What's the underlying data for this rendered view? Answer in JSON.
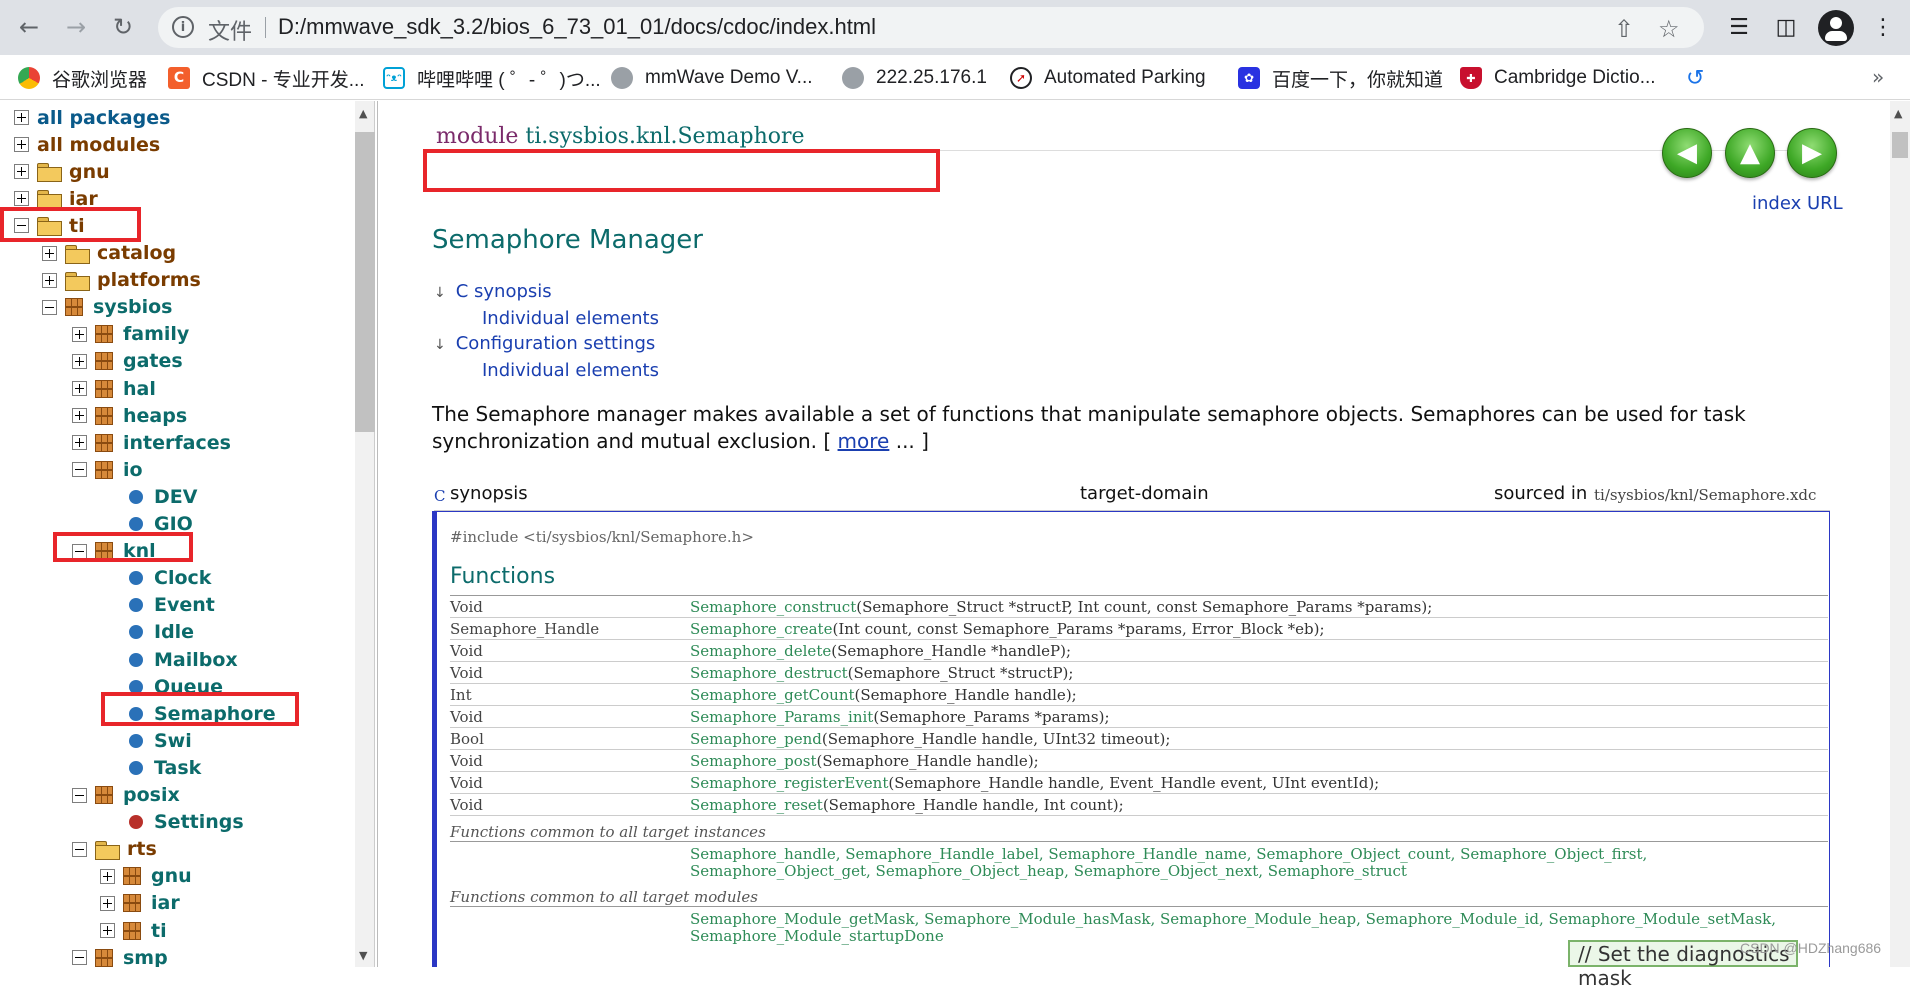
{
  "browser": {
    "url_chip": "文件",
    "url": "D:/mmwave_sdk_3.2/bios_6_73_01_01/docs/cdoc/index.html",
    "bookmarks": [
      "谷歌浏览器",
      "CSDN - 专业开发...",
      "哔哩哔哩 ( ゜- ゜)つ...",
      "mmWave Demo V...",
      "222.25.176.1",
      "Automated Parking",
      "百度一下，你就知道",
      "Cambridge Dictio..."
    ],
    "bookmark_more": "»"
  },
  "tree": {
    "items": [
      {
        "label": "all packages",
        "depth": 0,
        "toggle": "plus",
        "icon": "none",
        "color": "#0a5a8a"
      },
      {
        "label": "all modules",
        "depth": 0,
        "toggle": "plus",
        "icon": "none",
        "color": "#7a3c00"
      },
      {
        "label": "gnu",
        "depth": 0,
        "toggle": "plus",
        "icon": "folder",
        "color": "#7a3c00"
      },
      {
        "label": "iar",
        "depth": 0,
        "toggle": "plus",
        "icon": "folder",
        "color": "#7a3c00"
      },
      {
        "label": "ti",
        "depth": 0,
        "toggle": "minus",
        "icon": "folder",
        "color": "#7a3c00"
      },
      {
        "label": "catalog",
        "depth": 1,
        "toggle": "plus",
        "icon": "folder",
        "color": "#7a3c00"
      },
      {
        "label": "platforms",
        "depth": 1,
        "toggle": "plus",
        "icon": "folder",
        "color": "#7a3c00"
      },
      {
        "label": "sysbios",
        "depth": 1,
        "toggle": "minus",
        "icon": "package",
        "color": "#0c6b6b"
      },
      {
        "label": "family",
        "depth": 2,
        "toggle": "plus",
        "icon": "package",
        "color": "#0c6b6b"
      },
      {
        "label": "gates",
        "depth": 2,
        "toggle": "plus",
        "icon": "package",
        "color": "#0c6b6b"
      },
      {
        "label": "hal",
        "depth": 2,
        "toggle": "plus",
        "icon": "package",
        "color": "#0c6b6b"
      },
      {
        "label": "heaps",
        "depth": 2,
        "toggle": "plus",
        "icon": "package",
        "color": "#0c6b6b"
      },
      {
        "label": "interfaces",
        "depth": 2,
        "toggle": "plus",
        "icon": "package",
        "color": "#0c6b6b"
      },
      {
        "label": "io",
        "depth": 2,
        "toggle": "minus",
        "icon": "package",
        "color": "#0c6b6b"
      },
      {
        "label": "DEV",
        "depth": 3,
        "toggle": "none",
        "icon": "bullet",
        "color": "#0c6b6b"
      },
      {
        "label": "GIO",
        "depth": 3,
        "toggle": "none",
        "icon": "bullet",
        "color": "#0c6b6b"
      },
      {
        "label": "knl",
        "depth": 2,
        "toggle": "minus",
        "icon": "package",
        "color": "#0c6b6b"
      },
      {
        "label": "Clock",
        "depth": 3,
        "toggle": "none",
        "icon": "bullet",
        "color": "#0c6b6b"
      },
      {
        "label": "Event",
        "depth": 3,
        "toggle": "none",
        "icon": "bullet",
        "color": "#0c6b6b"
      },
      {
        "label": "Idle",
        "depth": 3,
        "toggle": "none",
        "icon": "bullet",
        "color": "#0c6b6b"
      },
      {
        "label": "Mailbox",
        "depth": 3,
        "toggle": "none",
        "icon": "bullet",
        "color": "#0c6b6b"
      },
      {
        "label": "Queue",
        "depth": 3,
        "toggle": "none",
        "icon": "bullet",
        "color": "#0c6b6b"
      },
      {
        "label": "Semaphore",
        "depth": 3,
        "toggle": "none",
        "icon": "bullet",
        "color": "#0c6b6b"
      },
      {
        "label": "Swi",
        "depth": 3,
        "toggle": "none",
        "icon": "bullet",
        "color": "#0c6b6b"
      },
      {
        "label": "Task",
        "depth": 3,
        "toggle": "none",
        "icon": "bullet",
        "color": "#0c6b6b"
      },
      {
        "label": "posix",
        "depth": 2,
        "toggle": "minus",
        "icon": "package",
        "color": "#0c6b6b"
      },
      {
        "label": "Settings",
        "depth": 3,
        "toggle": "none",
        "icon": "bullet-red",
        "color": "#0c6b6b"
      },
      {
        "label": "rts",
        "depth": 2,
        "toggle": "minus",
        "icon": "folder",
        "color": "#7a3c00"
      },
      {
        "label": "gnu",
        "depth": 3,
        "toggle": "plus",
        "icon": "package",
        "color": "#0c6b6b"
      },
      {
        "label": "iar",
        "depth": 3,
        "toggle": "plus",
        "icon": "package",
        "color": "#0c6b6b"
      },
      {
        "label": "ti",
        "depth": 3,
        "toggle": "plus",
        "icon": "package",
        "color": "#0c6b6b"
      },
      {
        "label": "smp",
        "depth": 2,
        "toggle": "minus",
        "icon": "package",
        "color": "#0c6b6b"
      }
    ]
  },
  "doc": {
    "module_keyword": "module",
    "module_name": "ti.sysbios.knl.Semaphore",
    "index_url": "index URL",
    "title": "Semaphore Manager",
    "toc": [
      "C synopsis",
      "Individual elements",
      "Configuration settings",
      "Individual elements"
    ],
    "desc": "The Semaphore manager makes available a set of functions that manipulate semaphore objects. Semaphores can be used for task synchronization and mutual exclusion. [",
    "more": "more",
    "desc_end": "... ]",
    "syn_c": "C",
    "syn_label": "synopsis",
    "target": "target-domain",
    "sourced": "sourced in",
    "sourced_path": "ti/sysbios/knl/Semaphore.xdc",
    "include": "#include <ti/sysbios/knl/Semaphore.h>",
    "functions_title": "Functions",
    "functions": [
      {
        "type": "Void",
        "name": "Semaphore_construct",
        "args": "(Semaphore_Struct *structP, Int count, const Semaphore_Params *params);"
      },
      {
        "type": "Semaphore_Handle",
        "name": "Semaphore_create",
        "args": "(Int count, const Semaphore_Params *params, Error_Block *eb);"
      },
      {
        "type": "Void",
        "name": "Semaphore_delete",
        "args": "(Semaphore_Handle *handleP);"
      },
      {
        "type": "Void",
        "name": "Semaphore_destruct",
        "args": "(Semaphore_Struct *structP);"
      },
      {
        "type": "Int",
        "name": "Semaphore_getCount",
        "args": "(Semaphore_Handle handle);"
      },
      {
        "type": "Void",
        "name": "Semaphore_Params_init",
        "args": "(Semaphore_Params *params);"
      },
      {
        "type": "Bool",
        "name": "Semaphore_pend",
        "args": "(Semaphore_Handle handle, UInt32 timeout);"
      },
      {
        "type": "Void",
        "name": "Semaphore_post",
        "args": "(Semaphore_Handle handle);"
      },
      {
        "type": "Void",
        "name": "Semaphore_registerEvent",
        "args": "(Semaphore_Handle handle, Event_Handle event, UInt eventId);"
      },
      {
        "type": "Void",
        "name": "Semaphore_reset",
        "args": "(Semaphore_Handle handle, Int count);"
      }
    ],
    "common_instances_label": "Functions common to all target instances",
    "common_instances": "Semaphore_handle, Semaphore_Handle_label, Semaphore_Handle_name, Semaphore_Object_count, Semaphore_Object_first,",
    "common_instances2": "Semaphore_Object_get, Semaphore_Object_heap, Semaphore_Object_next, Semaphore_struct",
    "common_modules_label": "Functions common to all target modules",
    "common_modules": "Semaphore_Module_getMask, Semaphore_Module_hasMask, Semaphore_Module_heap, Semaphore_Module_id, Semaphore_Module_setMask,",
    "common_modules2": "Semaphore_Module_startupDone",
    "diag_tip": "// Set the diagnostics mask",
    "watermark": "CSDN @HDZhang686"
  },
  "colors": {
    "teal_text": "#0c6b6b",
    "link_blue": "#1a3fb0",
    "highlight_red": "#e8252a",
    "box_border": "#2b37c4"
  }
}
